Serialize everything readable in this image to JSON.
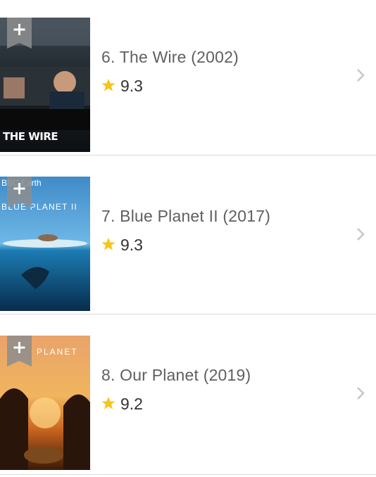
{
  "colors": {
    "star": "#f5c518",
    "divider": "#d9d9d9",
    "title": "#5f5f5f",
    "rating": "#333333",
    "chevron": "#c6c6c6"
  },
  "items": [
    {
      "title": "6. The Wire (2002)",
      "rating": "9.3",
      "poster_text": "THE WIRE",
      "add_icon": "plus-icon"
    },
    {
      "title": "7. Blue Planet II (2017)",
      "rating": "9.3",
      "poster_text": "BLUE PLANET II",
      "poster_subtext": "BBC Earth",
      "add_icon": "plus-icon"
    },
    {
      "title": "8. Our Planet (2019)",
      "rating": "9.2",
      "poster_text": "PLANET",
      "add_icon": "plus-icon"
    }
  ]
}
